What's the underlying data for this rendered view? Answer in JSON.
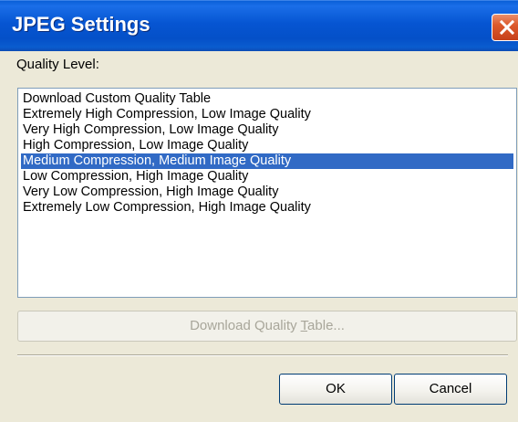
{
  "window": {
    "title": "JPEG Settings",
    "close_icon": "close-x-icon",
    "title_bar_color": "#0a5fd8",
    "close_button_color": "#dd5a2c"
  },
  "quality": {
    "label": "Quality Level:",
    "options": [
      "Download Custom Quality Table",
      "Extremely High Compression, Low Image Quality",
      "Very High Compression, Low Image Quality",
      "High Compression, Low Image Quality",
      "Medium Compression, Medium Image Quality",
      "Low Compression, High Image Quality",
      "Very Low Compression, High Image Quality",
      "Extremely Low Compression, High Image Quality"
    ],
    "selected": "Medium Compression, Medium Image Quality",
    "selection_color": "#316ac5"
  },
  "download_table_button": {
    "label_prefix": "Download Quality ",
    "label_accel": "T",
    "label_suffix": "able...",
    "enabled": false
  },
  "buttons": {
    "ok": "OK",
    "cancel": "Cancel"
  }
}
